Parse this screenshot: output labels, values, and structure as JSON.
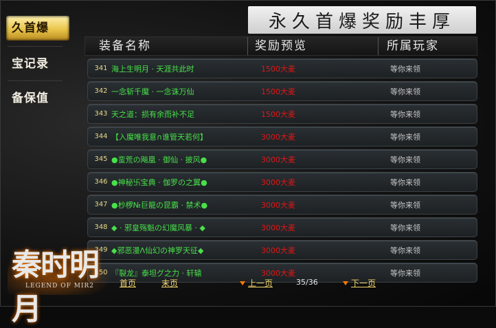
{
  "tabs": [
    {
      "label": "久首爆",
      "active": true
    },
    {
      "label": "宝记录",
      "active": false
    },
    {
      "label": "备保值",
      "active": false
    }
  ],
  "banner": {
    "title": "永久首爆奖励丰厚"
  },
  "table": {
    "headers": [
      "装备名称",
      "奖励预览",
      "所属玩家"
    ],
    "rows": [
      {
        "num": "341",
        "name": "海上生明月 · 天涯共此时",
        "reward": "1500大麦",
        "player": "等你来领"
      },
      {
        "num": "342",
        "name": "一念斩千魔 · 一念诛万仙",
        "reward": "1500大麦",
        "player": "等你来领"
      },
      {
        "num": "343",
        "name": "天之道：损有余而补不足",
        "reward": "1500大麦",
        "player": "等你来领"
      },
      {
        "num": "344",
        "name": "【入魔唯我意∩谁管天若何】",
        "reward": "3000大麦",
        "player": "等你来领"
      },
      {
        "num": "345",
        "name": "●蛮荒の飚凰 · 御仙 · 披风●",
        "reward": "3000大麦",
        "player": "等你来领"
      },
      {
        "num": "346",
        "name": "●神秘卐宝典 · 伽罗の之翼●",
        "reward": "3000大麦",
        "player": "等你来领"
      },
      {
        "num": "347",
        "name": "●杪椤№巨龍の昆霸 · 禁术●",
        "reward": "3000大麦",
        "player": "等你来领"
      },
      {
        "num": "348",
        "name": "◆ · 邪皇殇魁の幻魔风暴 · ◆",
        "reward": "3000大麦",
        "player": "等你来领"
      },
      {
        "num": "349",
        "name": "◆邪恶漫Λ仙幻の神罗天征◆",
        "reward": "3000大麦",
        "player": "等你来领"
      },
      {
        "num": "350",
        "name": "『裂龙』泰坦グ之力 · 轩辕",
        "reward": "3000大麦",
        "player": "等你来领"
      }
    ]
  },
  "logo": {
    "main": "秦时明月",
    "sub": "LEGEND OF MIR2"
  },
  "pager": {
    "first": "首页",
    "last": "末页",
    "prev": "上一页",
    "page_info": "35/36",
    "next": "下一页"
  }
}
